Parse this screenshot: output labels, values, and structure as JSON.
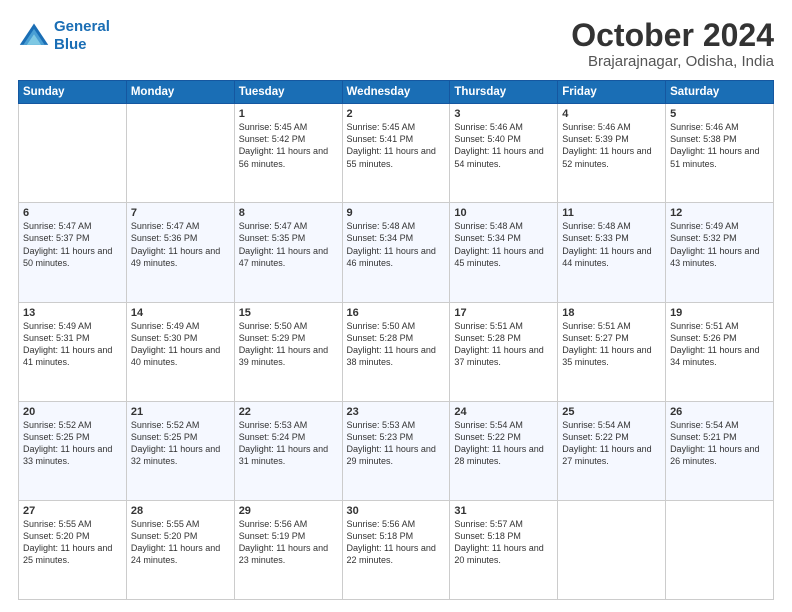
{
  "logo": {
    "line1": "General",
    "line2": "Blue"
  },
  "title": "October 2024",
  "subtitle": "Brajarajnagar, Odisha, India",
  "headers": [
    "Sunday",
    "Monday",
    "Tuesday",
    "Wednesday",
    "Thursday",
    "Friday",
    "Saturday"
  ],
  "weeks": [
    [
      {
        "day": "",
        "info": ""
      },
      {
        "day": "",
        "info": ""
      },
      {
        "day": "1",
        "info": "Sunrise: 5:45 AM\nSunset: 5:42 PM\nDaylight: 11 hours and 56 minutes."
      },
      {
        "day": "2",
        "info": "Sunrise: 5:45 AM\nSunset: 5:41 PM\nDaylight: 11 hours and 55 minutes."
      },
      {
        "day": "3",
        "info": "Sunrise: 5:46 AM\nSunset: 5:40 PM\nDaylight: 11 hours and 54 minutes."
      },
      {
        "day": "4",
        "info": "Sunrise: 5:46 AM\nSunset: 5:39 PM\nDaylight: 11 hours and 52 minutes."
      },
      {
        "day": "5",
        "info": "Sunrise: 5:46 AM\nSunset: 5:38 PM\nDaylight: 11 hours and 51 minutes."
      }
    ],
    [
      {
        "day": "6",
        "info": "Sunrise: 5:47 AM\nSunset: 5:37 PM\nDaylight: 11 hours and 50 minutes."
      },
      {
        "day": "7",
        "info": "Sunrise: 5:47 AM\nSunset: 5:36 PM\nDaylight: 11 hours and 49 minutes."
      },
      {
        "day": "8",
        "info": "Sunrise: 5:47 AM\nSunset: 5:35 PM\nDaylight: 11 hours and 47 minutes."
      },
      {
        "day": "9",
        "info": "Sunrise: 5:48 AM\nSunset: 5:34 PM\nDaylight: 11 hours and 46 minutes."
      },
      {
        "day": "10",
        "info": "Sunrise: 5:48 AM\nSunset: 5:34 PM\nDaylight: 11 hours and 45 minutes."
      },
      {
        "day": "11",
        "info": "Sunrise: 5:48 AM\nSunset: 5:33 PM\nDaylight: 11 hours and 44 minutes."
      },
      {
        "day": "12",
        "info": "Sunrise: 5:49 AM\nSunset: 5:32 PM\nDaylight: 11 hours and 43 minutes."
      }
    ],
    [
      {
        "day": "13",
        "info": "Sunrise: 5:49 AM\nSunset: 5:31 PM\nDaylight: 11 hours and 41 minutes."
      },
      {
        "day": "14",
        "info": "Sunrise: 5:49 AM\nSunset: 5:30 PM\nDaylight: 11 hours and 40 minutes."
      },
      {
        "day": "15",
        "info": "Sunrise: 5:50 AM\nSunset: 5:29 PM\nDaylight: 11 hours and 39 minutes."
      },
      {
        "day": "16",
        "info": "Sunrise: 5:50 AM\nSunset: 5:28 PM\nDaylight: 11 hours and 38 minutes."
      },
      {
        "day": "17",
        "info": "Sunrise: 5:51 AM\nSunset: 5:28 PM\nDaylight: 11 hours and 37 minutes."
      },
      {
        "day": "18",
        "info": "Sunrise: 5:51 AM\nSunset: 5:27 PM\nDaylight: 11 hours and 35 minutes."
      },
      {
        "day": "19",
        "info": "Sunrise: 5:51 AM\nSunset: 5:26 PM\nDaylight: 11 hours and 34 minutes."
      }
    ],
    [
      {
        "day": "20",
        "info": "Sunrise: 5:52 AM\nSunset: 5:25 PM\nDaylight: 11 hours and 33 minutes."
      },
      {
        "day": "21",
        "info": "Sunrise: 5:52 AM\nSunset: 5:25 PM\nDaylight: 11 hours and 32 minutes."
      },
      {
        "day": "22",
        "info": "Sunrise: 5:53 AM\nSunset: 5:24 PM\nDaylight: 11 hours and 31 minutes."
      },
      {
        "day": "23",
        "info": "Sunrise: 5:53 AM\nSunset: 5:23 PM\nDaylight: 11 hours and 29 minutes."
      },
      {
        "day": "24",
        "info": "Sunrise: 5:54 AM\nSunset: 5:22 PM\nDaylight: 11 hours and 28 minutes."
      },
      {
        "day": "25",
        "info": "Sunrise: 5:54 AM\nSunset: 5:22 PM\nDaylight: 11 hours and 27 minutes."
      },
      {
        "day": "26",
        "info": "Sunrise: 5:54 AM\nSunset: 5:21 PM\nDaylight: 11 hours and 26 minutes."
      }
    ],
    [
      {
        "day": "27",
        "info": "Sunrise: 5:55 AM\nSunset: 5:20 PM\nDaylight: 11 hours and 25 minutes."
      },
      {
        "day": "28",
        "info": "Sunrise: 5:55 AM\nSunset: 5:20 PM\nDaylight: 11 hours and 24 minutes."
      },
      {
        "day": "29",
        "info": "Sunrise: 5:56 AM\nSunset: 5:19 PM\nDaylight: 11 hours and 23 minutes."
      },
      {
        "day": "30",
        "info": "Sunrise: 5:56 AM\nSunset: 5:18 PM\nDaylight: 11 hours and 22 minutes."
      },
      {
        "day": "31",
        "info": "Sunrise: 5:57 AM\nSunset: 5:18 PM\nDaylight: 11 hours and 20 minutes."
      },
      {
        "day": "",
        "info": ""
      },
      {
        "day": "",
        "info": ""
      }
    ]
  ]
}
